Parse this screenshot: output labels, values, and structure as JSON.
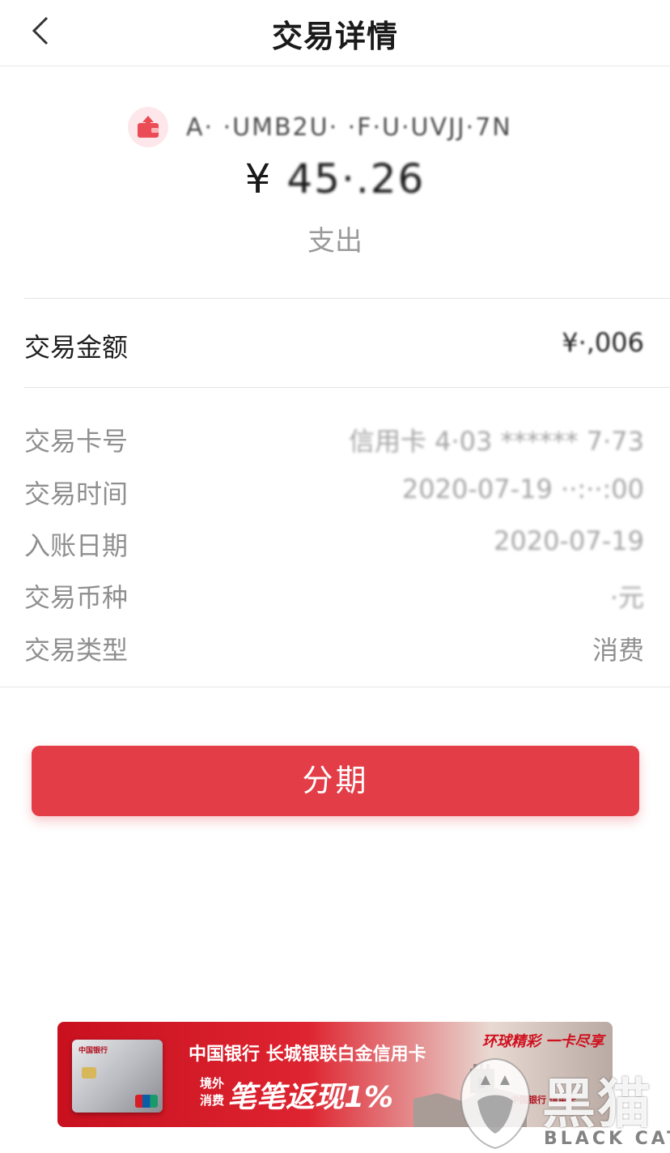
{
  "nav": {
    "title": "交易详情"
  },
  "summary": {
    "merchant": "A· ·UMB2U· ·F·U·UVJJ·7N",
    "currency_symbol": "¥",
    "amount": "45·.26",
    "direction": "支出"
  },
  "amount_row": {
    "label": "交易金额",
    "value": "¥·,006"
  },
  "details": [
    {
      "label": "交易卡号",
      "value": "信用卡 4·03 ****** 7·73"
    },
    {
      "label": "交易时间",
      "value": "2020-07-19 ··:··:00"
    },
    {
      "label": "入账日期",
      "value": "2020-07-19"
    },
    {
      "label": "交易币种",
      "value": "·元"
    },
    {
      "label": "交易类型",
      "value": "消费"
    }
  ],
  "action": {
    "installment_label": "分期"
  },
  "banner": {
    "title": "中国银行 长城银联白金信用卡",
    "small_line1": "境外",
    "small_line2": "消费",
    "cashback": "笔笔返现1%",
    "slogan": "环球精彩 一卡尽享",
    "card_logo": "中国银行",
    "bank_mark": "中国银行 信用卡"
  },
  "watermark": {
    "chinese": "黑猫",
    "english": "BLACK CAT"
  },
  "colors": {
    "accent": "#e33d47",
    "label_gray": "#8f8f8f",
    "icon_bg": "#fde7ea"
  }
}
